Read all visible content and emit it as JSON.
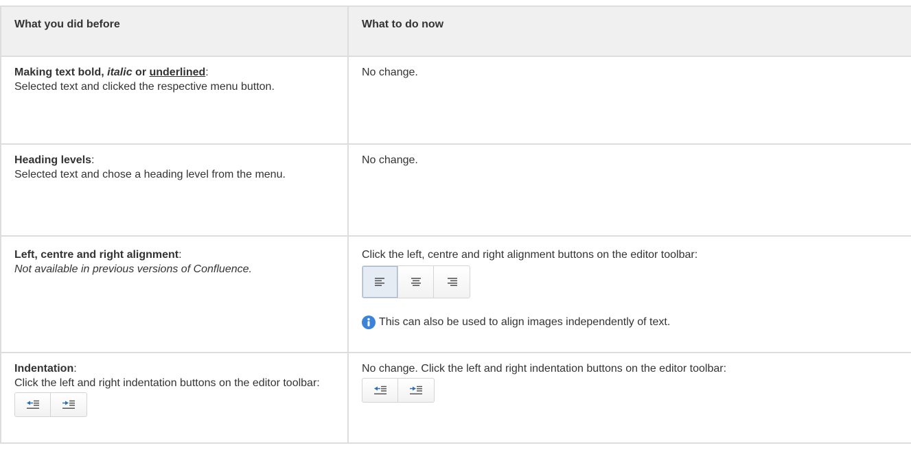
{
  "table": {
    "headers": [
      "What you did before",
      "What to do now"
    ],
    "rows": [
      {
        "before_bold_start": "Making text bold, ",
        "before_italic": "italic",
        "before_bold_mid": " or ",
        "before_underline": "underlined",
        "before_colon": ":",
        "before_text": "Selected text and clicked the respective menu button.",
        "now_text": "No change."
      },
      {
        "before_title": "Heading levels",
        "before_colon": ":",
        "before_text": "Selected text and chose a heading level from the menu.",
        "now_text": "No change."
      },
      {
        "before_title": "Left, centre and right alignment",
        "before_colon": ":",
        "before_italic_text": "Not available in previous versions of Confluence.",
        "now_text": "Click the left, centre and right alignment buttons on the editor toolbar:",
        "now_buttons": [
          "align-left-icon",
          "align-center-icon",
          "align-right-icon"
        ],
        "now_note": "This can also be used to align images independently of text."
      },
      {
        "before_title": "Indentation",
        "before_colon": ":",
        "before_text": "Click the left and right indentation buttons on the editor toolbar:",
        "before_buttons": [
          "outdent-icon",
          "indent-icon"
        ],
        "now_text": "No change. Click the left and right indentation buttons on the editor toolbar:",
        "now_buttons": [
          "outdent-icon",
          "indent-icon"
        ]
      }
    ]
  },
  "colors": {
    "border": "#dddddd",
    "header_bg": "#f0f0f0",
    "text": "#333333",
    "info_icon": "#3b83d8",
    "icon_blue": "#2f6fb5"
  }
}
